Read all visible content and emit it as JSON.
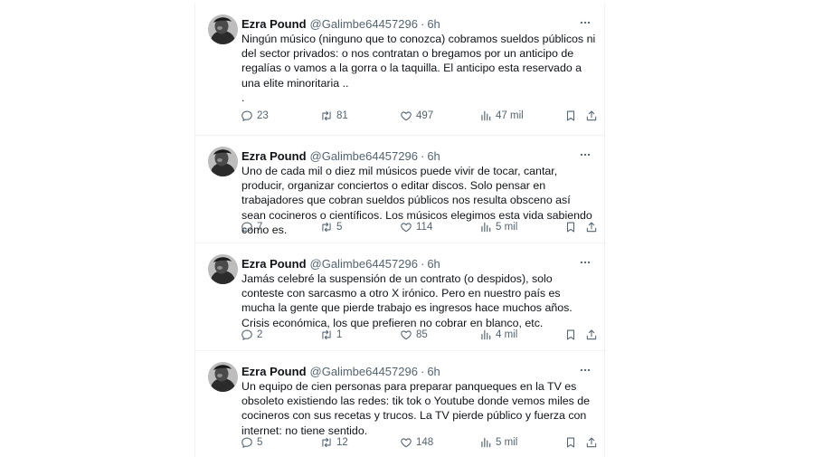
{
  "tweets": [
    {
      "name": "Ezra Pound",
      "handle": "@Galimbe64457296",
      "separator": "·",
      "time": "6h",
      "text": "Ningún músico (ninguno que to conozca) cobramos sueldos públicos ni del sector privados: o nos contratan o bregamos por un anticipo de regalías o vamos a la gorra o la taquilla. El anticipo esta reservado a una elite minoritaria ..\n.",
      "replies": "23",
      "retweets": "81",
      "likes": "497",
      "views": "47 mil"
    },
    {
      "name": "Ezra Pound",
      "handle": "@Galimbe64457296",
      "separator": "·",
      "time": "6h",
      "text": "Uno de cada mil o diez mil músicos puede vivir de tocar, cantar, producir, organizar conciertos o editar discos. Solo pensar en trabajadores que cobran sueldos públicos nos resulta obsceno así sean cocineros o científicos. Los músicos elegimos esta vida sabiendo como es.",
      "replies": "7",
      "retweets": "5",
      "likes": "114",
      "views": "5 mil"
    },
    {
      "name": "Ezra Pound",
      "handle": "@Galimbe64457296",
      "separator": "·",
      "time": "6h",
      "text": "Jamás celebré la suspensión de un contrato (o despidos), solo conteste con sarcasmo a otro X irónico. Pero en nuestro país es mucha la gente que pierde trabajo es ingresos hace muchos años. Crisis económica, los que prefieren no cobrar en blanco, etc.",
      "replies": "2",
      "retweets": "1",
      "likes": "85",
      "views": "4 mil"
    },
    {
      "name": "Ezra Pound",
      "handle": "@Galimbe64457296",
      "separator": "·",
      "time": "6h",
      "text": "Un equipo de cien personas para preparar panqueques en la TV es obsoleto existiendo las redes: tik tok o Youtube donde vemos miles de cocineros con sus recetas y trucos. La TV pierde público y fuerza con internet: no tiene sentido.",
      "replies": "5",
      "retweets": "12",
      "likes": "148",
      "views": "5 mil"
    }
  ],
  "icons": {
    "avatar": "avatar-photo",
    "more": "more-horizontal-icon",
    "reply": "reply-icon",
    "retweet": "retweet-icon",
    "like": "heart-icon",
    "views": "views-chart-icon",
    "bookmark": "bookmark-icon",
    "share": "share-icon"
  },
  "colors": {
    "text": "#0f1419",
    "secondary": "#536471",
    "divider": "#eff3f4"
  }
}
